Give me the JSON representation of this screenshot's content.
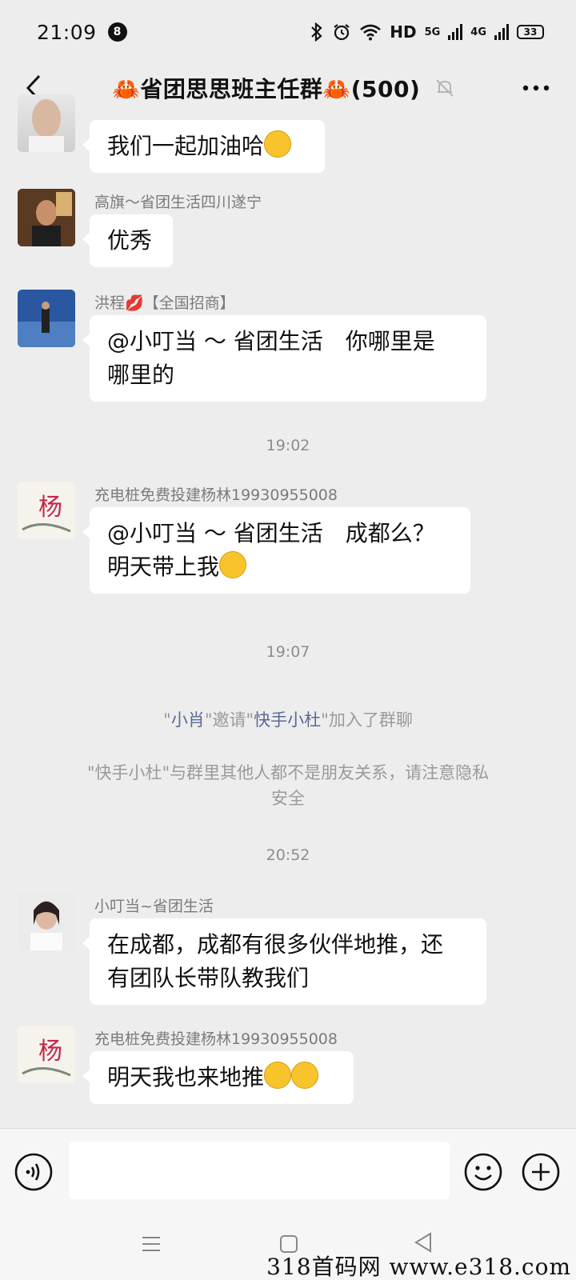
{
  "status_bar": {
    "time": "21:09",
    "notification_count": "8",
    "network_hd": "HD",
    "network_5g": "5G",
    "network_4g": "4G",
    "battery": "33"
  },
  "header": {
    "title": "🦀省团思思班主任群🦀(500)"
  },
  "messages": [
    {
      "sender": "",
      "text": "我们一起加油哈"
    },
    {
      "sender": "高旗～省团生活四川遂宁",
      "text": "优秀"
    },
    {
      "sender": "洪程💋【全国招商】",
      "line1": "@小叮当 ～ 省团生活　你哪里是",
      "line2": "哪里的"
    },
    {
      "sender": "充电桩免费投建杨林19930955008",
      "line1": "@小叮当 ～ 省团生活　成都么？",
      "line2": "明天带上我"
    },
    {
      "sender": "小叮当~省团生活",
      "line1": "在成都，成都有很多伙伴地推，还",
      "line2": "有团队长带队教我们"
    },
    {
      "sender": "充电桩免费投建杨林19930955008",
      "text": "明天我也来地推"
    }
  ],
  "timestamps": [
    "19:02",
    "19:07",
    "20:52"
  ],
  "system_messages": {
    "invite": {
      "q1": "\"",
      "inviter": "小肖",
      "q2": "\"邀请\"",
      "invitee": "快手小杜",
      "q3": "\"加入了群聊"
    },
    "warning_line1": "\"快手小杜\"与群里其他人都不是朋友关系，请注意隐私",
    "warning_line2": "安全"
  },
  "input": {
    "placeholder": ""
  },
  "watermark": "318首码网  www.e318.com",
  "colors": {
    "background": "#ededed",
    "bubble": "#ffffff",
    "link": "#576b95",
    "meta": "#8d8d8d"
  }
}
